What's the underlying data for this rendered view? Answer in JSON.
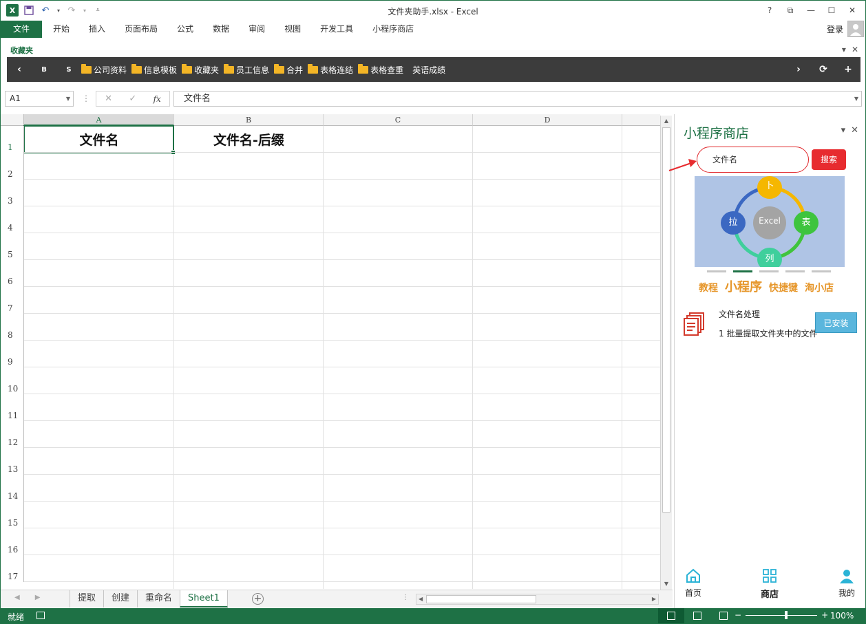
{
  "window": {
    "title": "文件夹助手.xlsx - Excel",
    "controls": [
      "?",
      "⧉",
      "—",
      "☐",
      "✕"
    ]
  },
  "ribbon": {
    "file_tab": "文件",
    "tabs": [
      "开始",
      "插入",
      "页面布局",
      "公式",
      "数据",
      "审阅",
      "视图",
      "开发工具",
      "小程序商店"
    ],
    "login": "登录"
  },
  "favorites": {
    "title": "收藏夹",
    "letters": [
      "B",
      "S"
    ],
    "folders": [
      "公司资料",
      "信息模板",
      "收藏夹",
      "员工信息",
      "合并",
      "表格连结",
      "表格查重"
    ],
    "last_item": "英语成绩"
  },
  "formula_bar": {
    "name_box": "A1",
    "content": "文件名"
  },
  "sheet": {
    "columns": [
      "A",
      "B",
      "C",
      "D"
    ],
    "rows": [
      "1",
      "2",
      "3",
      "4",
      "5",
      "6",
      "7",
      "8",
      "9",
      "10",
      "11",
      "12",
      "13",
      "14",
      "15",
      "16",
      "17"
    ],
    "cells": {
      "A1": "文件名",
      "B1": "文件名-后缀"
    }
  },
  "sheet_tabs": {
    "tabs": [
      "提取",
      "创建",
      "重命名",
      "Sheet1"
    ],
    "active": "Sheet1"
  },
  "status": {
    "ready": "就绪",
    "zoom": "100%"
  },
  "panel": {
    "title": "小程序商店",
    "search_value": "文件名",
    "search_button": "搜索",
    "banner": {
      "center": "Excel",
      "top": "卜",
      "left": "拉",
      "right": "表",
      "bottom": "列"
    },
    "carousel_active_index": 1,
    "menu": [
      "教程",
      "小程序",
      "快捷键",
      "淘小店"
    ],
    "app": {
      "name": "文件名处理",
      "index": "1",
      "desc": "批量提取文件夹中的文件",
      "status": "已安装"
    },
    "nav": [
      "首页",
      "商店",
      "我的"
    ],
    "nav_active": "商店"
  }
}
